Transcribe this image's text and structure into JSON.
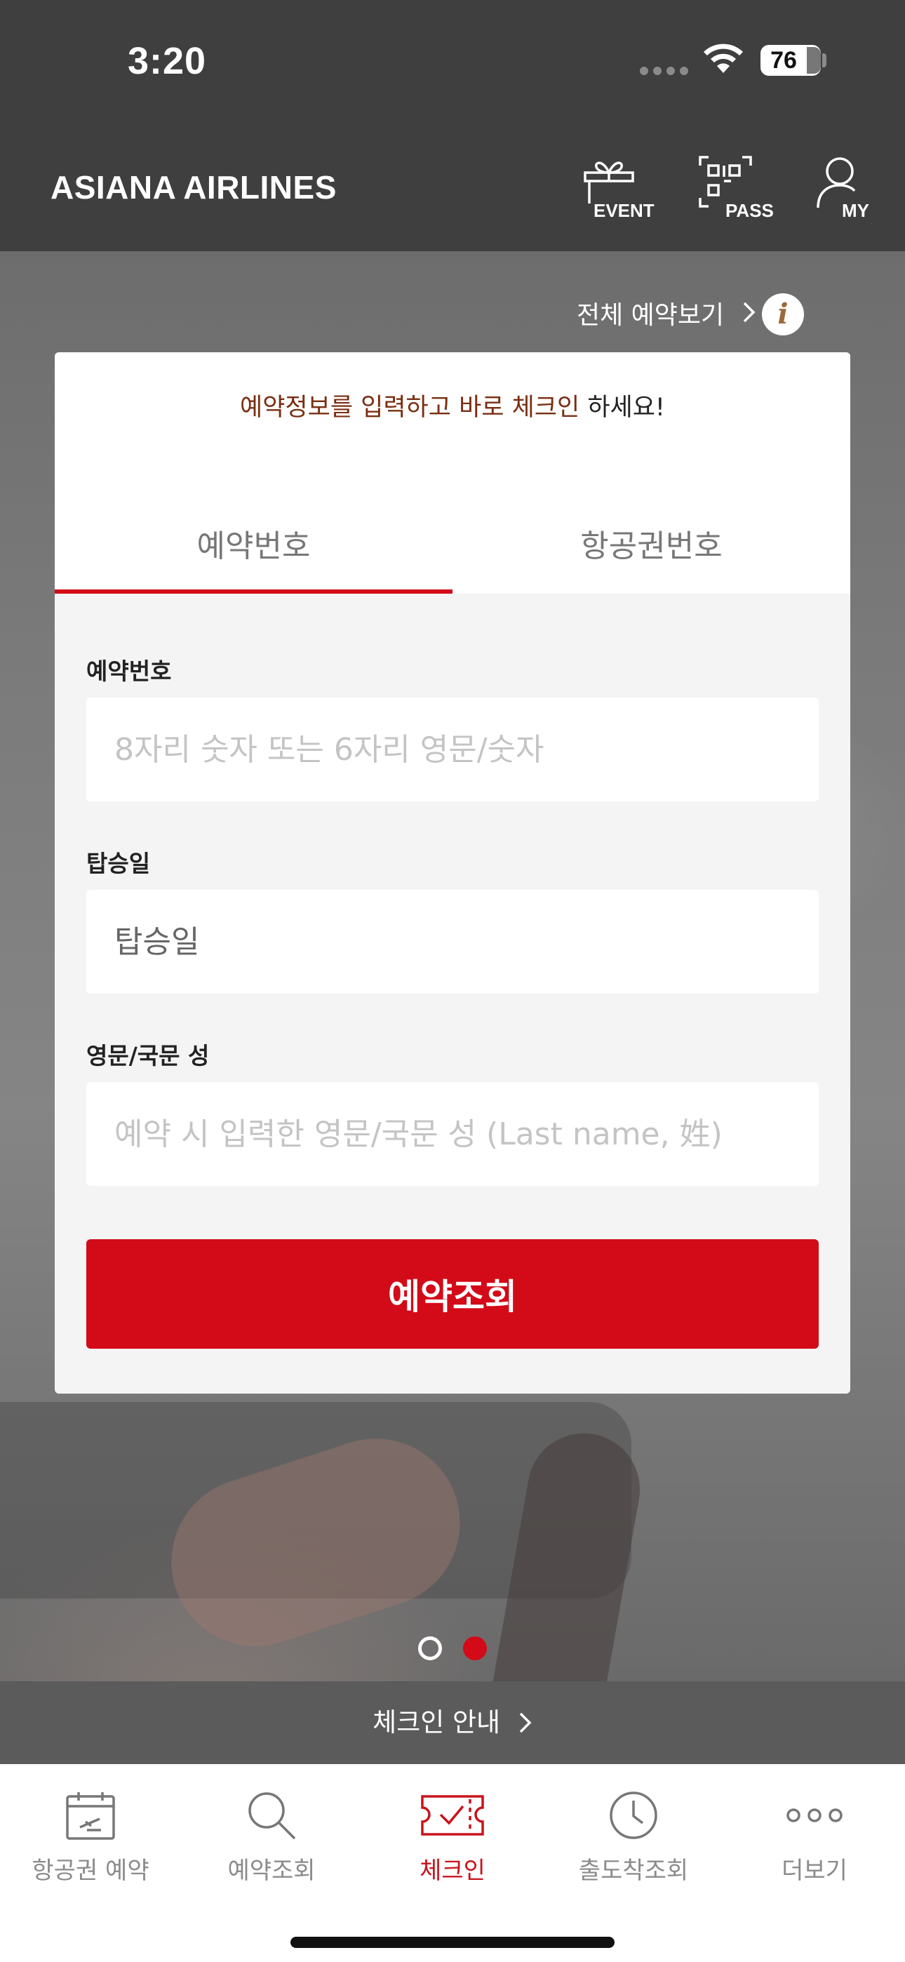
{
  "status_bar": {
    "time": "3:20",
    "battery": "76"
  },
  "header": {
    "brand": "ASIANA AIRLINES",
    "buttons": [
      {
        "label": "EVENT",
        "icon": "gift-icon"
      },
      {
        "label": "PASS",
        "icon": "qr-code-icon"
      },
      {
        "label": "MY",
        "icon": "user-icon"
      }
    ]
  },
  "hero": {
    "view_all": "전체 예약보기",
    "info": "i"
  },
  "card": {
    "promo_accent": "예약정보를 입력하고 바로 체크인",
    "promo_rest": " 하세요!",
    "tabs": [
      {
        "label": "예약번호",
        "active": true
      },
      {
        "label": "항공권번호",
        "active": false
      }
    ],
    "fields": {
      "booking_label": "예약번호",
      "booking_placeholder": "8자리 숫자 또는 6자리 영문/숫자",
      "date_label": "탑승일",
      "date_placeholder": "탑승일",
      "name_label": "영문/국문 성",
      "name_placeholder": "예약 시 입력한 영문/국문 성 (Last name, 姓)"
    },
    "submit": "예약조회"
  },
  "pager": {
    "count": 2,
    "active_index": 1
  },
  "guide": {
    "label": "체크인 안내"
  },
  "tabbar": {
    "items": [
      {
        "label": "항공권 예약",
        "icon": "calendar-plane-icon"
      },
      {
        "label": "예약조회",
        "icon": "search-icon"
      },
      {
        "label": "체크인",
        "icon": "ticket-check-icon",
        "active": true
      },
      {
        "label": "출도착조회",
        "icon": "clock-icon"
      },
      {
        "label": "더보기",
        "icon": "more-dots-icon"
      }
    ]
  },
  "colors": {
    "accent": "#d30a17",
    "header": "#3f3f3f",
    "promo_accent": "#7a2e12"
  }
}
